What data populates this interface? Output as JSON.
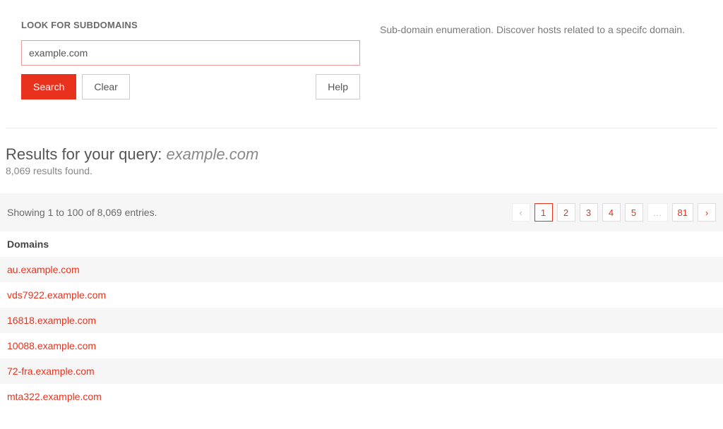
{
  "search": {
    "section_title": "LOOK FOR SUBDOMAINS",
    "input_value": "example.com",
    "search_label": "Search",
    "clear_label": "Clear",
    "help_label": "Help",
    "description": "Sub-domain enumeration. Discover hosts related to a specifc domain."
  },
  "results": {
    "title_prefix": "Results for your query: ",
    "query": "example.com",
    "found_text": "8,069 results found.",
    "showing_text": "Showing 1 to 100 of 8,069 entries.",
    "header": "Domains",
    "domains": [
      "au.example.com",
      "vds7922.example.com",
      "16818.example.com",
      "10088.example.com",
      "72-fra.example.com",
      "mta322.example.com"
    ]
  },
  "pagination": {
    "prev": "‹",
    "next": "›",
    "ellipsis": "…",
    "pages": [
      "1",
      "2",
      "3",
      "4",
      "5"
    ],
    "last": "81",
    "current_index": 0
  }
}
